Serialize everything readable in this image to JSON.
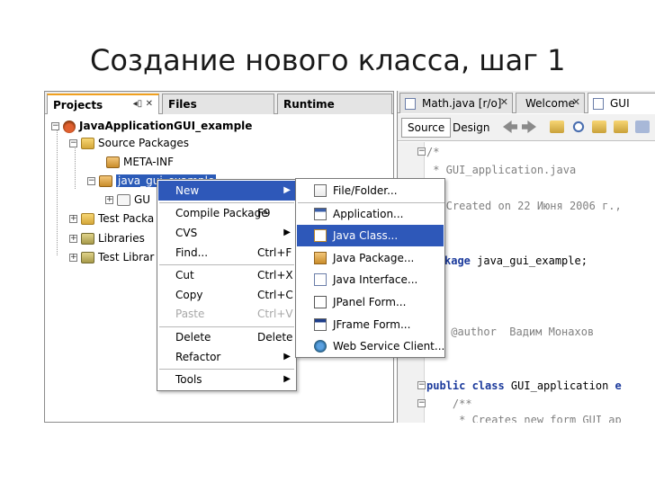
{
  "slide": {
    "title": "Создание нового класса, шаг 1"
  },
  "projects_panel": {
    "tabs": [
      {
        "label": "Projects",
        "active": true
      },
      {
        "label": "Files",
        "active": false
      },
      {
        "label": "Runtime",
        "active": false
      }
    ],
    "tree": {
      "project": "JavaApplicationGUI_example",
      "source_packages": "Source Packages",
      "meta_inf": "META-INF",
      "package": "java_gui_example",
      "file_partial": "GU",
      "test_packages": "Test Packa",
      "libraries": "Libraries",
      "test_libraries": "Test Librar"
    }
  },
  "editor": {
    "tabs": [
      {
        "label": "Math.java [r/o]"
      },
      {
        "label": "Welcome"
      },
      {
        "label": "GUI"
      }
    ],
    "toolbar": {
      "source": "Source",
      "design": "Design"
    },
    "code_lines": [
      "/*",
      " * GUI_application.java",
      " *",
      " * Created on 22 Июня 2006 г.,",
      "",
      "kage java_gui_example;",
      "",
      "",
      "",
      " @author  Вадим Монахов",
      "",
      "",
      "public class GUI_application e",
      "    /**",
      "     * Creates new form GUI_ap"
    ]
  },
  "context_menu": {
    "items": [
      {
        "label": "New",
        "shortcut": "",
        "submenu": true,
        "highlight": true,
        "disabled": false
      },
      {
        "label": "Compile Package",
        "shortcut": "F9",
        "submenu": false,
        "highlight": false,
        "disabled": false
      },
      {
        "label": "CVS",
        "shortcut": "",
        "submenu": true,
        "highlight": false,
        "disabled": false
      },
      {
        "label": "Find...",
        "shortcut": "Ctrl+F",
        "submenu": false,
        "highlight": false,
        "disabled": false
      },
      {
        "label": "Cut",
        "shortcut": "Ctrl+X",
        "submenu": false,
        "highlight": false,
        "disabled": false
      },
      {
        "label": "Copy",
        "shortcut": "Ctrl+C",
        "submenu": false,
        "highlight": false,
        "disabled": false
      },
      {
        "label": "Paste",
        "shortcut": "Ctrl+V",
        "submenu": false,
        "highlight": false,
        "disabled": true
      },
      {
        "label": "Delete",
        "shortcut": "Delete",
        "submenu": false,
        "highlight": false,
        "disabled": false
      },
      {
        "label": "Refactor",
        "shortcut": "",
        "submenu": true,
        "highlight": false,
        "disabled": false
      },
      {
        "label": "Tools",
        "shortcut": "",
        "submenu": true,
        "highlight": false,
        "disabled": false
      }
    ]
  },
  "new_submenu": {
    "items": [
      {
        "label": "File/Folder...",
        "icon": "file-folder-icon"
      },
      {
        "label": "Application...",
        "icon": "application-icon"
      },
      {
        "label": "Java Class...",
        "icon": "java-class-icon",
        "highlight": true
      },
      {
        "label": "Java Package...",
        "icon": "java-package-icon"
      },
      {
        "label": "Java Interface...",
        "icon": "java-interface-icon"
      },
      {
        "label": "JPanel Form...",
        "icon": "jpanel-form-icon"
      },
      {
        "label": "JFrame Form...",
        "icon": "jframe-form-icon"
      },
      {
        "label": "Web Service Client...",
        "icon": "globe-icon"
      }
    ]
  },
  "colors": {
    "highlight": "#2e58b9",
    "keyword": "#1b3a9c",
    "comment": "#808080"
  }
}
